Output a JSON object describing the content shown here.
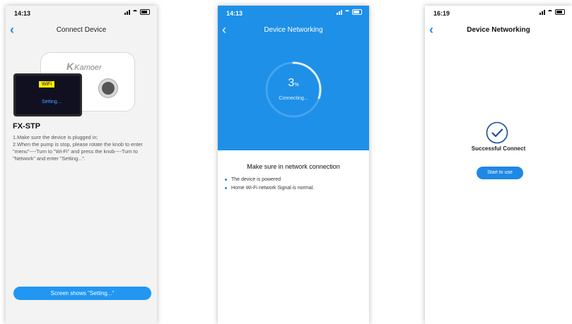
{
  "colors": {
    "accent": "#1e88e5",
    "header_blue": "#1e90e8",
    "screen_bg": "#101020",
    "wifi_tag": "#ffee00"
  },
  "screen1": {
    "time": "14:13",
    "title": "Connect Device",
    "brand": "Kamoer",
    "wifi_tag": "WiFi",
    "screen_status": "Setting...",
    "model": "FX-STP",
    "instruction_1": "1.Make sure the device is plugged in;",
    "instruction_2": "2.When the pump is stop, please rotate the knob to enter \"menu\"----Turn to \"Wi-Fi\" and press the knob----Turn to \"Network\" and enter \"Setting...\".",
    "button": "Screen shows \"Setting...\""
  },
  "screen2": {
    "time": "14:13",
    "title": "Device Networking",
    "progress_value": "3",
    "progress_unit": "%",
    "progress_fraction": 0.03,
    "connecting": "Connecting...",
    "tip_heading": "Make sure in network connection",
    "tips": [
      "The device is powered",
      "Home Wi-Fi network Signal is normal."
    ]
  },
  "screen3": {
    "time": "16:19",
    "title": "Device Networking",
    "message": "Successful Connect",
    "button": "Start to use"
  }
}
